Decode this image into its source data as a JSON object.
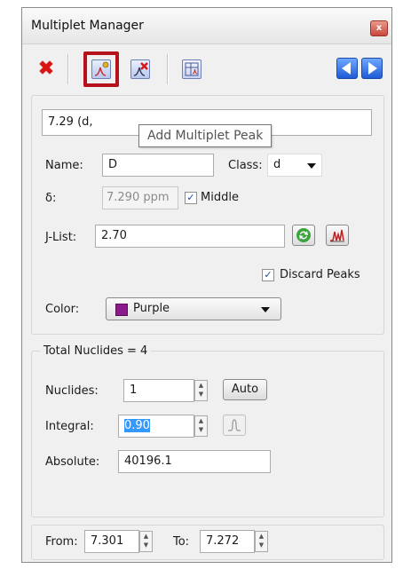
{
  "window": {
    "title": "Multiplet Manager",
    "close_glyph": "x"
  },
  "toolbar": {
    "buttons": [
      {
        "name": "delete-multiplet-button",
        "icon": "red-x-icon"
      },
      {
        "name": "add-multiplet-peak-button",
        "icon": "add-peak-icon",
        "highlighted": true
      },
      {
        "name": "remove-multiplet-peak-button",
        "icon": "remove-peak-icon"
      },
      {
        "name": "multiplet-table-button",
        "icon": "table-icon"
      },
      {
        "name": "previous-button",
        "icon": "arrow-left-icon"
      },
      {
        "name": "next-button",
        "icon": "arrow-right-icon"
      }
    ],
    "highlight_color": "#b5121b"
  },
  "multiplet": {
    "label_value": "7.29 (d,",
    "tooltip": "Add Multiplet Peak",
    "name_label": "Name:",
    "name_value": "D",
    "class_label": "Class:",
    "class_value": "d",
    "delta_label": "δ:",
    "delta_value": "7.290 ppm",
    "middle_label": "Middle",
    "middle_checked": true,
    "jlist_label": "J-List:",
    "jlist_value": "2.70",
    "discard_label": "Discard Peaks",
    "discard_checked": true,
    "color_label": "Color:",
    "color_value": "Purple",
    "color_swatch": "#8b1a8b"
  },
  "nuclides": {
    "total_label": "Total Nuclides = 4",
    "nuclides_label": "Nuclides:",
    "nuclides_value": "1",
    "auto_label": "Auto",
    "integral_label": "Integral:",
    "integral_value": "0.90",
    "absolute_label": "Absolute:",
    "absolute_value": "40196.1"
  },
  "range": {
    "from_label": "From:",
    "from_value": "7.301",
    "to_label": "To:",
    "to_value": "7.272"
  }
}
